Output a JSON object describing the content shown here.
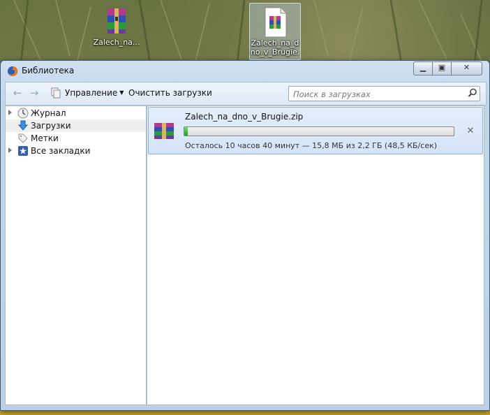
{
  "desktop": {
    "icons": [
      {
        "label": "Zalech_na...",
        "selected": false,
        "icon": "winrar-archive-icon"
      },
      {
        "label": "Zalech_na_dno_v_Brugie.",
        "selected": true,
        "icon": "winrar-document-icon"
      }
    ]
  },
  "window": {
    "title": "Библиотека",
    "app_icon": "firefox-icon",
    "controls": {
      "minimize": "minimize-icon",
      "maximize": "maximize-icon",
      "close": "close-icon"
    }
  },
  "toolbar": {
    "back_icon": "back-arrow-icon",
    "forward_icon": "forward-arrow-icon",
    "manage_label": "Управление",
    "clear_downloads_label": "Очистить загрузки",
    "search_placeholder": "Поиск в загрузках"
  },
  "sidebar": {
    "items": [
      {
        "label": "Журнал",
        "icon": "clock-icon",
        "expandable": true,
        "selected": false
      },
      {
        "label": "Загрузки",
        "icon": "download-arrow-icon",
        "expandable": false,
        "selected": true
      },
      {
        "label": "Метки",
        "icon": "tag-icon",
        "expandable": false,
        "selected": false
      },
      {
        "label": "Все закладки",
        "icon": "star-bookmark-icon",
        "expandable": true,
        "selected": false
      }
    ]
  },
  "downloads": [
    {
      "filename": "Zalech_na_dno_v_Brugie.zip",
      "progress": 0.007,
      "status": "Осталось 10 часов 40 минут — 15,8 МБ из 2,2 ГБ (48,5 КБ/сек)"
    }
  ],
  "colors": {
    "progress_fill": "#1fa21f",
    "selection": "#d4e4f7",
    "window_frame": "#c2d6ea"
  }
}
